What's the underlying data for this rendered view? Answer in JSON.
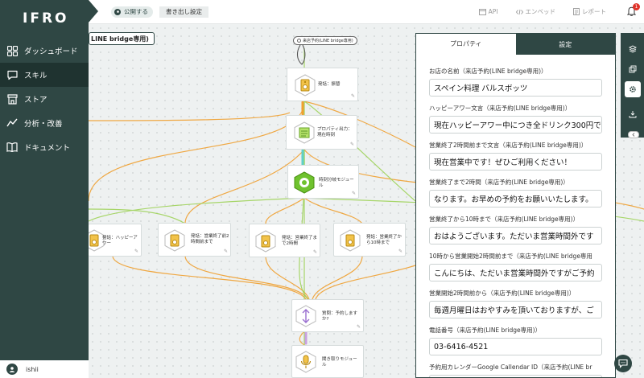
{
  "app": {
    "logo": "IFRO"
  },
  "sidebar": {
    "items": [
      {
        "label": "ダッシュボード",
        "icon": "dashboard-icon"
      },
      {
        "label": "スキル",
        "icon": "skill-chat-icon"
      },
      {
        "label": "ストア",
        "icon": "store-icon"
      },
      {
        "label": "分析・改善",
        "icon": "analytics-icon"
      },
      {
        "label": "ドキュメント",
        "icon": "document-icon"
      }
    ],
    "active_index": 1,
    "user": {
      "name": "ishii"
    }
  },
  "topbar": {
    "publish_label": "公開する",
    "export_label": "書き出し設定",
    "api_label": "API",
    "endpoint_label": "エンベッド",
    "report_label": "レポート",
    "notification_count": "1"
  },
  "canvas": {
    "skill_title": "LINE bridge専用)",
    "start_node": "来店予約(LINE bridge専用)",
    "nodes": [
      {
        "id": "n1",
        "label": "発話：振替"
      },
      {
        "id": "n2",
        "label": "プロパティ出力：現在時刻"
      },
      {
        "id": "n3",
        "label": "時刻分岐モジュール"
      },
      {
        "id": "n4",
        "label": "発話：ハッピーアワー"
      },
      {
        "id": "n5",
        "label": "発話：営業終了前2時間前まで"
      },
      {
        "id": "n6",
        "label": "発話：営業終了まで2時間"
      },
      {
        "id": "n7",
        "label": "発話：営業終了から10時まで"
      },
      {
        "id": "n8",
        "label": "質問：予約しますか?"
      },
      {
        "id": "n9",
        "label": "聞き取りモジュール"
      }
    ]
  },
  "panel": {
    "tabs": [
      "プロパティ",
      "設定"
    ],
    "active_tab": 0,
    "fields": [
      {
        "label": "お店の名前（来店予約(LINE bridge専用)）",
        "value": "スペイン料理 バルスボッツ"
      },
      {
        "label": "ハッピーアワー文言（来店予約(LINE bridge専用)）",
        "value": "現在ハッピーアワー中につき全ドリンク300円で"
      },
      {
        "label": "営業終了2時間前まで文言（来店予約(LINE bridge専用)）",
        "value": "現在営業中です！ぜひご利用ください！"
      },
      {
        "label": "営業終了まで2時間（来店予約(LINE bridge専用)）",
        "value": "なります。お早めの予約をお願いいたします。"
      },
      {
        "label": "営業終了から10時まで（来店予約(LINE bridge専用)）",
        "value": "おはようございます。ただいま営業時間外です"
      },
      {
        "label": "10時から営業開始2時間前まで（来店予約(LINE bridge専用",
        "value": "こんにちは、ただいま営業時間外ですがご予約"
      },
      {
        "label": "営業開始2時間前から（来店予約(LINE bridge専用)）",
        "value": "毎週月曜日はおやすみを頂いておりますが、ご"
      },
      {
        "label": "電話番号（来店予約(LINE bridge専用)）",
        "value": "03-6416-4521"
      },
      {
        "label": "予約用カレンダーGoogle Callendar ID（来店予約(LINE br",
        "value": ""
      }
    ]
  },
  "colors": {
    "primary": "#2f4744",
    "accent_orange": "#f0a030",
    "accent_green": "#9fd35a",
    "badge_red": "#e0332a"
  }
}
